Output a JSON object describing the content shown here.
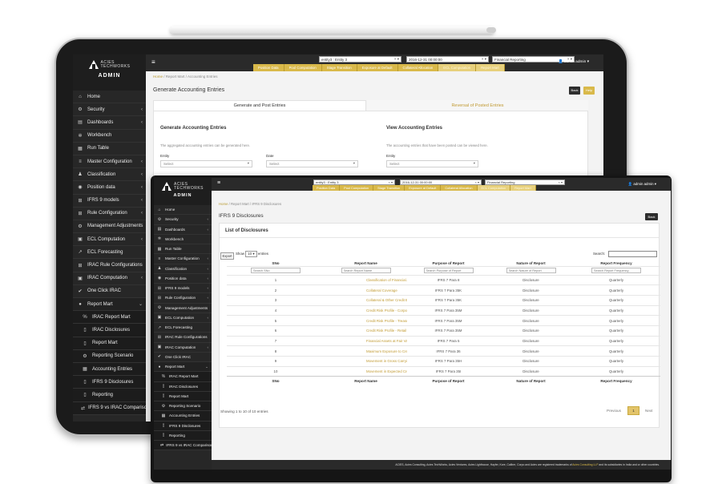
{
  "brand": {
    "line1": "ACIES",
    "line2": "TECHWORKS",
    "role": "ADMIN"
  },
  "topbar": {
    "entity": "entity3 : Entity 3",
    "date": "2016-12-31 00:00:00",
    "report": "Financial Reporting",
    "user": "admin admin",
    "tabs": [
      "Position Data",
      "Pool Computation",
      "Stage Transition",
      "Exposure at Default",
      "Collateral Allocation",
      "ECL Computation",
      "Report Mart"
    ]
  },
  "back_screen": {
    "sidebar": [
      {
        "label": "Home",
        "icon": "home-icon"
      },
      {
        "label": "Security",
        "icon": "gear-icon",
        "chev": true
      },
      {
        "label": "Dashboards",
        "icon": "dashboard-icon",
        "chev": true
      },
      {
        "label": "Workbench",
        "icon": "cog-icon"
      },
      {
        "label": "Run Table",
        "icon": "table-icon"
      },
      {
        "label": "Master Configuration",
        "icon": "sliders-icon",
        "chev": true
      },
      {
        "label": "Classification",
        "icon": "users-icon",
        "chev": true
      },
      {
        "label": "Position data",
        "icon": "database-icon",
        "chev": true
      },
      {
        "label": "IFRS 9 models",
        "icon": "grid-icon",
        "chev": true
      },
      {
        "label": "Rule Configuration",
        "icon": "grid-icon",
        "chev": true
      },
      {
        "label": "Management Adjustments",
        "icon": "gear-icon"
      },
      {
        "label": "ECL Computation",
        "icon": "calc-icon",
        "chev": true
      },
      {
        "label": "ECL Forecasting",
        "icon": "chart-icon"
      },
      {
        "label": "IRAC Rule Configurations",
        "icon": "grid-icon"
      },
      {
        "label": "IRAC Computation",
        "icon": "calc-icon",
        "chev": true
      },
      {
        "label": "One Click IRAC",
        "icon": "check-icon"
      },
      {
        "label": "Report Mart",
        "icon": "circle-icon",
        "chev": true,
        "open": true
      },
      {
        "label": "IRAC Report Mart",
        "icon": "percent-icon",
        "sub": true
      },
      {
        "label": "IRAC Disclosures",
        "icon": "doc-icon",
        "sub": true
      },
      {
        "label": "Report Mart",
        "icon": "doc-icon",
        "sub": true
      },
      {
        "label": "Reporting Scenario",
        "icon": "gear-icon",
        "sub": true
      },
      {
        "label": "Accounting Entries",
        "icon": "table-icon",
        "sub": true
      },
      {
        "label": "IFRS 9 Disclosures",
        "icon": "doc-icon",
        "sub": true
      },
      {
        "label": "Reporting",
        "icon": "doc-icon",
        "sub": true
      },
      {
        "label": "IFRS 9 vs IRAC Comparison",
        "icon": "compare-icon",
        "sub": true
      }
    ],
    "breadcrumb": {
      "home": "Home",
      "path": " / Report Mart / Accounting Entries"
    },
    "title": "Generate Accounting Entries",
    "back_label": "Back",
    "help_label": "Help",
    "tabs": [
      "Generate and Post Entries",
      "Reversal of Posted Entries"
    ],
    "left": {
      "heading": "Generate Accounting Entries",
      "text": "The aggregated accounting entries can be generated here.",
      "entity_label": "Entity",
      "date_label": "Date",
      "select": "Select"
    },
    "right": {
      "heading": "View Accounting Entries",
      "text": "The accounting entries that have been posted can be viewed here.",
      "entity_label": "Entity",
      "select": "Select"
    }
  },
  "front_screen": {
    "sidebar": [
      {
        "label": "Home",
        "icon": "home-icon"
      },
      {
        "label": "Security",
        "icon": "gear-icon",
        "chev": true
      },
      {
        "label": "Dashboards",
        "icon": "dashboard-icon",
        "chev": true
      },
      {
        "label": "Workbench",
        "icon": "cog-icon"
      },
      {
        "label": "Run Table",
        "icon": "table-icon"
      },
      {
        "label": "Master Configuration",
        "icon": "sliders-icon",
        "chev": true
      },
      {
        "label": "Classification",
        "icon": "users-icon",
        "chev": true
      },
      {
        "label": "Position data",
        "icon": "database-icon",
        "chev": true
      },
      {
        "label": "IFRS 9 models",
        "icon": "grid-icon",
        "chev": true
      },
      {
        "label": "Rule Configuration",
        "icon": "grid-icon",
        "chev": true
      },
      {
        "label": "Management Adjustments",
        "icon": "gear-icon"
      },
      {
        "label": "ECL Computation",
        "icon": "calc-icon",
        "chev": true
      },
      {
        "label": "ECL Forecasting",
        "icon": "chart-icon"
      },
      {
        "label": "IRAC Rule Configurations",
        "icon": "grid-icon"
      },
      {
        "label": "IRAC Computation",
        "icon": "calc-icon",
        "chev": true
      },
      {
        "label": "One Click IRAC",
        "icon": "check-icon"
      },
      {
        "label": "Report Mart",
        "icon": "circle-icon",
        "chev": true,
        "open": true
      },
      {
        "label": "IRAC Report Mart",
        "icon": "percent-icon",
        "sub": true
      },
      {
        "label": "IRAC Disclosures",
        "icon": "doc-icon",
        "sub": true
      },
      {
        "label": "Report Mart",
        "icon": "doc-icon",
        "sub": true
      },
      {
        "label": "Reporting Scenario",
        "icon": "gear-icon",
        "sub": true
      },
      {
        "label": "Accounting Entries",
        "icon": "table-icon",
        "sub": true
      },
      {
        "label": "IFRS 9 Disclosures",
        "icon": "doc-icon",
        "sub": true
      },
      {
        "label": "Reporting",
        "icon": "doc-icon",
        "sub": true
      },
      {
        "label": "IFRS 9 vs IRAC Comparison",
        "icon": "compare-icon",
        "sub": true
      }
    ],
    "breadcrumb": {
      "home": "Home",
      "path": " / Report Mart / IFRS 9 Disclosures"
    },
    "title": "IFRS 9 Disclosures",
    "back_label": "Back",
    "list_title": "List of Disclosures",
    "export_label": "Export",
    "show_label": "Show",
    "show_value": "10",
    "entries_label": "entries",
    "search_label": "Search:",
    "columns": [
      "SNo",
      "Report Name",
      "Purpose of Report",
      "Nature of Report",
      "Report Frequency"
    ],
    "filters": [
      "Search SNo",
      "Search Report Name",
      "Search Purpose of Report",
      "Search Nature of Report",
      "Search Report Frequency"
    ],
    "rows": [
      [
        "1",
        "Classification of Financial Assets",
        "IFRS 7 Para 8",
        "Disclosure",
        "Quarterly"
      ],
      [
        "2",
        "Collateral Coverage",
        "IFRS 7 Para 35K",
        "Disclosure",
        "Quarterly"
      ],
      [
        "3",
        "Collateral & Other Credit Enhancements",
        "IFRS 7 Para 35K",
        "Disclosure",
        "Quarterly"
      ],
      [
        "4",
        "Credit Risk Profile - Corporate",
        "IFRS 7 Para 35M",
        "Disclosure",
        "Quarterly"
      ],
      [
        "5",
        "Credit Risk Profile - Treasury",
        "IFRS 7 Para 35M",
        "Disclosure",
        "Quarterly"
      ],
      [
        "6",
        "Credit Risk Profile - Retail",
        "IFRS 7 Para 35M",
        "Disclosure",
        "Quarterly"
      ],
      [
        "7",
        "Financial Assets at Fair Value",
        "IFRS 7 Para 5",
        "Disclosure",
        "Quarterly"
      ],
      [
        "8",
        "Maximum Exposure to Credit Risk",
        "IFRS 7 Para 36",
        "Disclosure",
        "Quarterly"
      ],
      [
        "9",
        "Movement in Gross Carrying Amount",
        "IFRS 7 Para 35H",
        "Disclosure",
        "Quarterly"
      ],
      [
        "10",
        "Movement in Expected Credit Loss",
        "IFRS 7 Para 35I",
        "Disclosure",
        "Quarterly"
      ]
    ],
    "showing": "Showing 1 to 10 of 10 entries",
    "pager": {
      "prev": "Previous",
      "page": "1",
      "next": "Next"
    },
    "footer": {
      "prefix": "ACIES, Acies Consulting, Acies TechWorks, Acies Ventures, Acies Lighthouse, Hayfer, Kore, Calibre, Corpo and Acies are registered trademarks of ",
      "company": "Acies Consulting LLP",
      "suffix": " and its subsidiaries in India and or other countries."
    }
  }
}
